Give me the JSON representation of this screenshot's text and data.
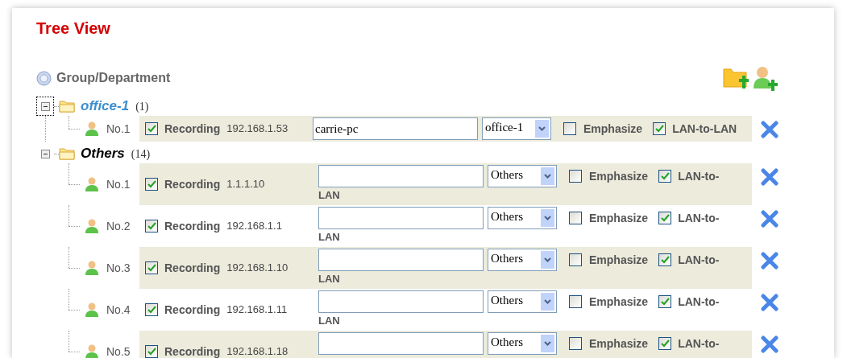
{
  "title": "Tree View",
  "root": {
    "label": "Group/Department"
  },
  "groups": [
    {
      "name": "office-1",
      "count": "(1)",
      "expanded": true,
      "selected": true,
      "devices": [
        {
          "number": "No.1",
          "recording": true,
          "recording_label": "Recording",
          "ip": "192.168.1.53",
          "name_value": "carrie-pc",
          "group_select": "office-1",
          "emphasize": false,
          "emphasize_label": "Emphasize",
          "lan_to_lan": true,
          "lan_label_lines": [
            "LAN-to-LAN"
          ]
        }
      ]
    },
    {
      "name": "Others",
      "count": "(14)",
      "expanded": true,
      "selected": false,
      "devices": [
        {
          "number": "No.1",
          "recording": true,
          "recording_label": "Recording",
          "ip": "1.1.1.10",
          "group_select": "Others",
          "emphasize": false,
          "emphasize_label": "Emphasize",
          "lan_to_lan": true,
          "lan_label_lines": [
            "LAN-to-",
            "LAN"
          ]
        },
        {
          "number": "No.2",
          "recording": true,
          "recording_label": "Recording",
          "ip": "192.168.1.1",
          "group_select": "Others",
          "emphasize": false,
          "emphasize_label": "Emphasize",
          "lan_to_lan": true,
          "lan_label_lines": [
            "LAN-to-",
            "LAN"
          ]
        },
        {
          "number": "No.3",
          "recording": true,
          "recording_label": "Recording",
          "ip": "192.168.1.10",
          "group_select": "Others",
          "emphasize": false,
          "emphasize_label": "Emphasize",
          "lan_to_lan": true,
          "lan_label_lines": [
            "LAN-to-",
            "LAN"
          ]
        },
        {
          "number": "No.4",
          "recording": true,
          "recording_label": "Recording",
          "ip": "192.168.1.11",
          "group_select": "Others",
          "emphasize": false,
          "emphasize_label": "Emphasize",
          "lan_to_lan": true,
          "lan_label_lines": [
            "LAN-to-",
            "LAN"
          ]
        },
        {
          "number": "No.5",
          "recording": true,
          "recording_label": "Recording",
          "ip": "192.168.1.18",
          "group_select": "Others",
          "emphasize": false,
          "emphasize_label": "Emphasize",
          "lan_to_lan": true,
          "lan_label_lines": [
            "LAN-to-"
          ]
        }
      ]
    }
  ]
}
